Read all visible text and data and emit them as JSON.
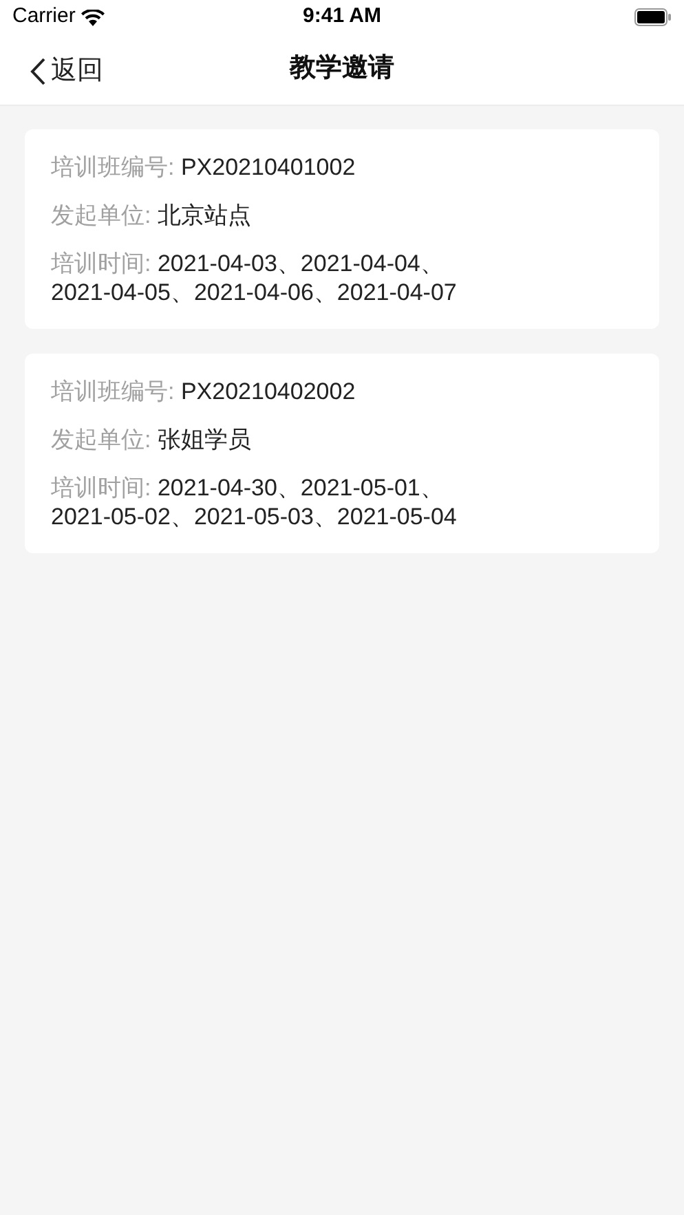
{
  "status_bar": {
    "carrier": "Carrier",
    "time": "9:41 AM"
  },
  "nav": {
    "back": "返回",
    "title": "教学邀请"
  },
  "invitations": [
    {
      "fields": [
        {
          "label": "培训班编号:",
          "value": "PX20210401002"
        },
        {
          "label": "发起单位:",
          "value": "北京站点"
        },
        {
          "label": "培训时间:",
          "value": "2021-04-03、2021-04-04、2021-04-05、2021-04-06、2021-04-07"
        }
      ]
    },
    {
      "fields": [
        {
          "label": "培训班编号:",
          "value": "PX20210402002"
        },
        {
          "label": "发起单位:",
          "value": "张姐学员"
        },
        {
          "label": "培训时间:",
          "value": "2021-04-30、2021-05-01、2021-05-02、2021-05-03、2021-05-04"
        }
      ]
    }
  ]
}
